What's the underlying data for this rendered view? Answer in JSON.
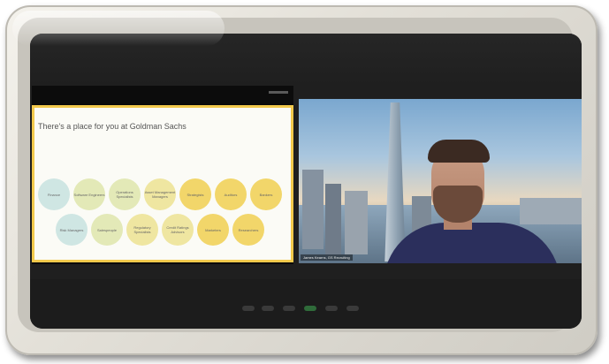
{
  "slide": {
    "title": "There's a place for you at Goldman Sachs",
    "circles_row1": [
      "Finance",
      "Software Engineers",
      "Operations Specialists",
      "Asset Management Managers",
      "Strategists",
      "Auditors",
      "Bankers"
    ],
    "circles_row2": [
      "Risk Managers",
      "Salespeople",
      "Regulatory Specialists",
      "Credit Ratings Advisors",
      "Marketers",
      "Researchers"
    ],
    "colors": {
      "teal": "#cfe6e3",
      "green": "#e3e9b7",
      "light_yellow": "#efe6a1",
      "yellow": "#f2d66a",
      "border": "#f2c94c"
    }
  },
  "video": {
    "name_tag": "James Kearns, GS Recruiting"
  }
}
